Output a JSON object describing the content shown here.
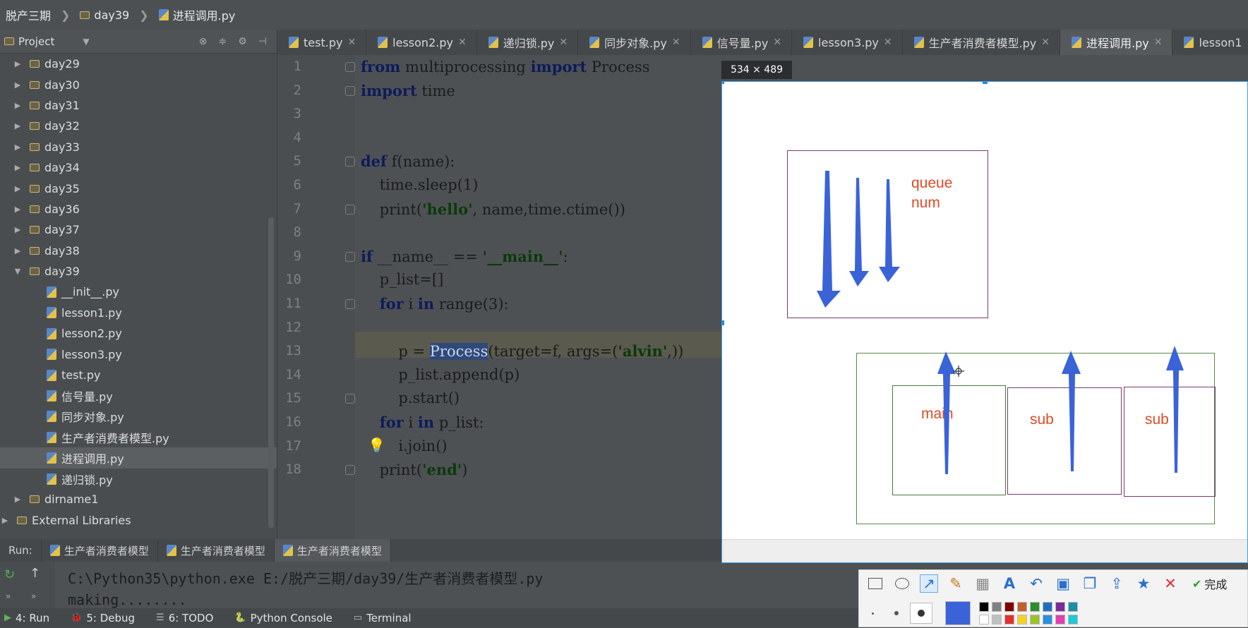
{
  "breadcrumb": [
    "脱产三期",
    "day39",
    "进程调用.py"
  ],
  "project": {
    "header": "Project",
    "items": [
      {
        "label": "day29",
        "type": "folder",
        "depth": 1,
        "expanded": false
      },
      {
        "label": "day30",
        "type": "folder",
        "depth": 1,
        "expanded": false
      },
      {
        "label": "day31",
        "type": "folder",
        "depth": 1,
        "expanded": false
      },
      {
        "label": "day32",
        "type": "folder",
        "depth": 1,
        "expanded": false
      },
      {
        "label": "day33",
        "type": "folder",
        "depth": 1,
        "expanded": false
      },
      {
        "label": "day34",
        "type": "folder",
        "depth": 1,
        "expanded": false
      },
      {
        "label": "day35",
        "type": "folder",
        "depth": 1,
        "expanded": false
      },
      {
        "label": "day36",
        "type": "folder",
        "depth": 1,
        "expanded": false
      },
      {
        "label": "day37",
        "type": "folder",
        "depth": 1,
        "expanded": false
      },
      {
        "label": "day38",
        "type": "folder",
        "depth": 1,
        "expanded": false
      },
      {
        "label": "day39",
        "type": "folder",
        "depth": 1,
        "expanded": true
      },
      {
        "label": "__init__.py",
        "type": "file",
        "depth": 2
      },
      {
        "label": "lesson1.py",
        "type": "file",
        "depth": 2
      },
      {
        "label": "lesson2.py",
        "type": "file",
        "depth": 2
      },
      {
        "label": "lesson3.py",
        "type": "file",
        "depth": 2
      },
      {
        "label": "test.py",
        "type": "file",
        "depth": 2
      },
      {
        "label": "信号量.py",
        "type": "file",
        "depth": 2
      },
      {
        "label": "同步对象.py",
        "type": "file",
        "depth": 2
      },
      {
        "label": "生产者消费者模型.py",
        "type": "file",
        "depth": 2
      },
      {
        "label": "进程调用.py",
        "type": "file",
        "depth": 2,
        "selected": true
      },
      {
        "label": "递归锁.py",
        "type": "file",
        "depth": 2
      },
      {
        "label": "dirname1",
        "type": "folder",
        "depth": 1,
        "expanded": false
      },
      {
        "label": "External Libraries",
        "type": "lib",
        "depth": 0,
        "expanded": false
      }
    ]
  },
  "tabs": [
    {
      "label": "test.py"
    },
    {
      "label": "lesson2.py"
    },
    {
      "label": "递归锁.py"
    },
    {
      "label": "同步对象.py"
    },
    {
      "label": "信号量.py"
    },
    {
      "label": "lesson3.py"
    },
    {
      "label": "生产者消费者模型.py"
    },
    {
      "label": "进程调用.py",
      "active": true
    },
    {
      "label": "lesson1"
    }
  ],
  "editor": {
    "line_numbers": [
      "1",
      "2",
      "3",
      "4",
      "5",
      "6",
      "7",
      "8",
      "9",
      "10",
      "11",
      "12",
      "13",
      "14",
      "15",
      "16",
      "17",
      "18"
    ],
    "lines": [
      {
        "indent": "",
        "parts": [
          [
            "kw",
            "from"
          ],
          [
            "",
            "multiprocessing"
          ],
          [
            "kw",
            "import"
          ],
          [
            "",
            "Process"
          ]
        ]
      },
      {
        "indent": "",
        "parts": [
          [
            "kw",
            "import"
          ],
          [
            "",
            "time"
          ]
        ]
      },
      {
        "indent": "",
        "parts": []
      },
      {
        "indent": "",
        "parts": []
      },
      {
        "indent": "",
        "parts": [
          [
            "kw",
            "def"
          ],
          [
            "",
            "f(name):"
          ]
        ]
      },
      {
        "indent": "    ",
        "parts": [
          [
            "",
            "time.sleep(1)"
          ]
        ]
      },
      {
        "indent": "    ",
        "parts": [
          [
            "",
            "print("
          ],
          [
            "str",
            "'hello'"
          ],
          [
            "",
            ", name,time.ctime())"
          ]
        ]
      },
      {
        "indent": "",
        "parts": []
      },
      {
        "indent": "",
        "parts": [
          [
            "kw",
            "if"
          ],
          [
            "",
            "__name__ == "
          ],
          [
            "str",
            "'__main__'"
          ],
          [
            "",
            ":"
          ]
        ]
      },
      {
        "indent": "    ",
        "parts": [
          [
            "",
            "p_list=[]"
          ]
        ]
      },
      {
        "indent": "    ",
        "parts": [
          [
            "kw",
            "for"
          ],
          [
            "",
            "i"
          ],
          [
            "kw",
            "in"
          ],
          [
            "",
            "range(3):"
          ]
        ]
      },
      {
        "indent": "",
        "parts": []
      },
      {
        "indent": "        ",
        "parts": [
          [
            "",
            "p = "
          ],
          [
            "sel",
            "Process"
          ],
          [
            "",
            "(target=f, args=("
          ],
          [
            "str",
            "'alvin'"
          ],
          [
            "",
            ",))"
          ]
        ]
      },
      {
        "indent": "        ",
        "parts": [
          [
            "",
            "p_list.append(p)"
          ]
        ]
      },
      {
        "indent": "        ",
        "parts": [
          [
            "",
            "p.start()"
          ]
        ]
      },
      {
        "indent": "    ",
        "parts": [
          [
            "kw",
            "for"
          ],
          [
            "",
            "i"
          ],
          [
            "kw",
            "in"
          ],
          [
            "",
            "p_list:"
          ]
        ]
      },
      {
        "indent": "        ",
        "parts": [
          [
            "",
            "i.join()"
          ]
        ]
      },
      {
        "indent": "    ",
        "parts": [
          [
            "",
            "print("
          ],
          [
            "str",
            "'end'"
          ],
          [
            "",
            ")"
          ]
        ]
      }
    ]
  },
  "run": {
    "label": "Run:",
    "tabs": [
      "生产者消费者模型",
      "生产者消费者模型",
      "生产者消费者模型"
    ],
    "console": [
      "C:\\Python35\\python.exe E:/脱产三期/day39/生产者消费者模型.py",
      "making........"
    ]
  },
  "statusbar": {
    "items": [
      "4: Run",
      "5: Debug",
      "6: TODO",
      "Python Console",
      "Terminal"
    ],
    "right": "1"
  },
  "capture": {
    "size_label": "534 × 489",
    "labels": {
      "queue": "queue",
      "num": "num",
      "main": "main",
      "sub1": "sub",
      "sub2": "sub"
    },
    "arrow_color": "#3a63d8"
  },
  "annotation_toolbar": {
    "tools": [
      "rectangle-icon",
      "ellipse-icon",
      "arrow-icon",
      "pen-icon",
      "mosaic-icon",
      "text-icon",
      "undo-icon",
      "save-icon",
      "copy-icon",
      "share-icon",
      "pin-icon",
      "cancel-icon"
    ],
    "done_label": "完成",
    "current_color": "#3a63d8",
    "palette": [
      "#000000",
      "#808080",
      "#800000",
      "#c0602a",
      "#2e8b2e",
      "#1f6fbf",
      "#7a2a9a",
      "#1a8ea5",
      "#ffffff",
      "#c0c0c0",
      "#e03030",
      "#f2d22a",
      "#9ac22a",
      "#2a8fe0",
      "#e040b0",
      "#20c8d8"
    ]
  }
}
